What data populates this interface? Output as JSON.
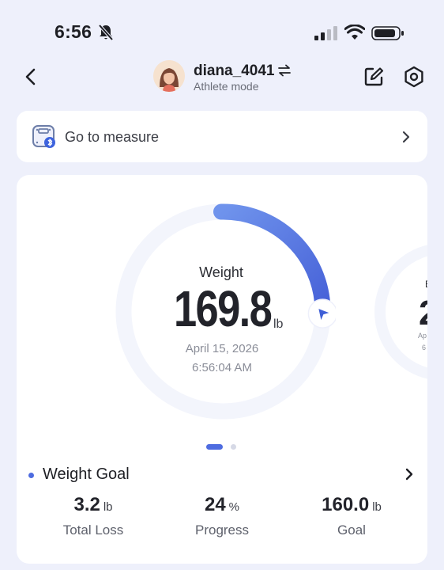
{
  "status_bar": {
    "time": "6:56",
    "icons": [
      "bell-slash-icon",
      "signal-icon",
      "wifi-icon",
      "battery-icon"
    ]
  },
  "header": {
    "username": "diana_4041",
    "mode": "Athlete mode",
    "icons": [
      "back-icon",
      "swap-icon",
      "edit-icon",
      "settings-icon"
    ]
  },
  "measure": {
    "label": "Go to measure",
    "icons": [
      "scale-bluetooth-icon",
      "chevron-right-icon"
    ]
  },
  "weight": {
    "label": "Weight",
    "value": "169.8",
    "unit": "lb",
    "date": "April 15, 2026",
    "time": "6:56:04 AM",
    "progress_fraction": 0.24
  },
  "next_panel": {
    "label": "B",
    "value": "2",
    "date": "Ap",
    "time": "6"
  },
  "carousel": {
    "pages": 2,
    "active": 1
  },
  "goal": {
    "title": "Weight Goal",
    "stats": [
      {
        "value": "3.2",
        "unit": "lb",
        "label": "Total Loss"
      },
      {
        "value": "24",
        "unit": "%",
        "label": "Progress"
      },
      {
        "value": "160.0",
        "unit": "lb",
        "label": "Goal"
      }
    ]
  },
  "colors": {
    "accent": "#4e6ce0",
    "background": "#eef0fb",
    "card": "#ffffff",
    "ring_track": "#f3f5fc"
  }
}
